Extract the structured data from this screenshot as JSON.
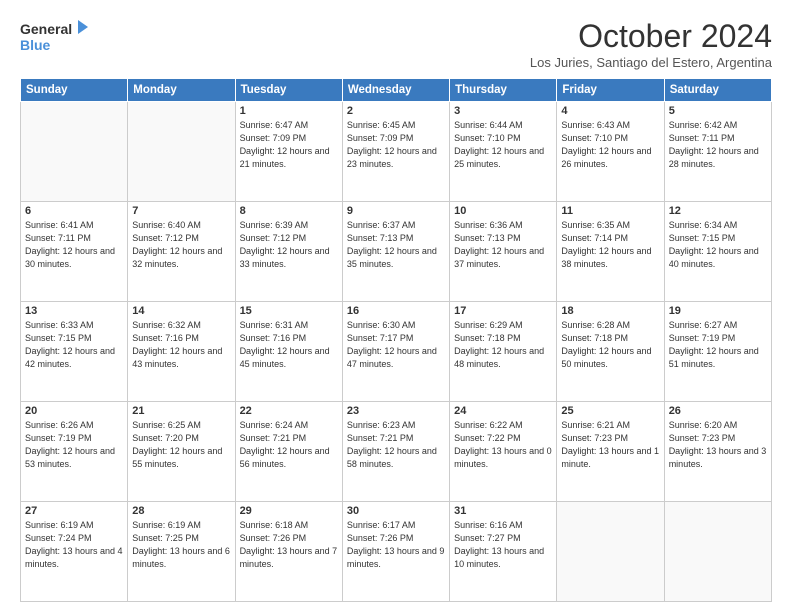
{
  "header": {
    "logo_line1": "General",
    "logo_line2": "Blue",
    "month_title": "October 2024",
    "subtitle": "Los Juries, Santiago del Estero, Argentina"
  },
  "days_of_week": [
    "Sunday",
    "Monday",
    "Tuesday",
    "Wednesday",
    "Thursday",
    "Friday",
    "Saturday"
  ],
  "weeks": [
    [
      {
        "day": "",
        "info": ""
      },
      {
        "day": "",
        "info": ""
      },
      {
        "day": "1",
        "info": "Sunrise: 6:47 AM\nSunset: 7:09 PM\nDaylight: 12 hours and 21 minutes."
      },
      {
        "day": "2",
        "info": "Sunrise: 6:45 AM\nSunset: 7:09 PM\nDaylight: 12 hours and 23 minutes."
      },
      {
        "day": "3",
        "info": "Sunrise: 6:44 AM\nSunset: 7:10 PM\nDaylight: 12 hours and 25 minutes."
      },
      {
        "day": "4",
        "info": "Sunrise: 6:43 AM\nSunset: 7:10 PM\nDaylight: 12 hours and 26 minutes."
      },
      {
        "day": "5",
        "info": "Sunrise: 6:42 AM\nSunset: 7:11 PM\nDaylight: 12 hours and 28 minutes."
      }
    ],
    [
      {
        "day": "6",
        "info": "Sunrise: 6:41 AM\nSunset: 7:11 PM\nDaylight: 12 hours and 30 minutes."
      },
      {
        "day": "7",
        "info": "Sunrise: 6:40 AM\nSunset: 7:12 PM\nDaylight: 12 hours and 32 minutes."
      },
      {
        "day": "8",
        "info": "Sunrise: 6:39 AM\nSunset: 7:12 PM\nDaylight: 12 hours and 33 minutes."
      },
      {
        "day": "9",
        "info": "Sunrise: 6:37 AM\nSunset: 7:13 PM\nDaylight: 12 hours and 35 minutes."
      },
      {
        "day": "10",
        "info": "Sunrise: 6:36 AM\nSunset: 7:13 PM\nDaylight: 12 hours and 37 minutes."
      },
      {
        "day": "11",
        "info": "Sunrise: 6:35 AM\nSunset: 7:14 PM\nDaylight: 12 hours and 38 minutes."
      },
      {
        "day": "12",
        "info": "Sunrise: 6:34 AM\nSunset: 7:15 PM\nDaylight: 12 hours and 40 minutes."
      }
    ],
    [
      {
        "day": "13",
        "info": "Sunrise: 6:33 AM\nSunset: 7:15 PM\nDaylight: 12 hours and 42 minutes."
      },
      {
        "day": "14",
        "info": "Sunrise: 6:32 AM\nSunset: 7:16 PM\nDaylight: 12 hours and 43 minutes."
      },
      {
        "day": "15",
        "info": "Sunrise: 6:31 AM\nSunset: 7:16 PM\nDaylight: 12 hours and 45 minutes."
      },
      {
        "day": "16",
        "info": "Sunrise: 6:30 AM\nSunset: 7:17 PM\nDaylight: 12 hours and 47 minutes."
      },
      {
        "day": "17",
        "info": "Sunrise: 6:29 AM\nSunset: 7:18 PM\nDaylight: 12 hours and 48 minutes."
      },
      {
        "day": "18",
        "info": "Sunrise: 6:28 AM\nSunset: 7:18 PM\nDaylight: 12 hours and 50 minutes."
      },
      {
        "day": "19",
        "info": "Sunrise: 6:27 AM\nSunset: 7:19 PM\nDaylight: 12 hours and 51 minutes."
      }
    ],
    [
      {
        "day": "20",
        "info": "Sunrise: 6:26 AM\nSunset: 7:19 PM\nDaylight: 12 hours and 53 minutes."
      },
      {
        "day": "21",
        "info": "Sunrise: 6:25 AM\nSunset: 7:20 PM\nDaylight: 12 hours and 55 minutes."
      },
      {
        "day": "22",
        "info": "Sunrise: 6:24 AM\nSunset: 7:21 PM\nDaylight: 12 hours and 56 minutes."
      },
      {
        "day": "23",
        "info": "Sunrise: 6:23 AM\nSunset: 7:21 PM\nDaylight: 12 hours and 58 minutes."
      },
      {
        "day": "24",
        "info": "Sunrise: 6:22 AM\nSunset: 7:22 PM\nDaylight: 13 hours and 0 minutes."
      },
      {
        "day": "25",
        "info": "Sunrise: 6:21 AM\nSunset: 7:23 PM\nDaylight: 13 hours and 1 minute."
      },
      {
        "day": "26",
        "info": "Sunrise: 6:20 AM\nSunset: 7:23 PM\nDaylight: 13 hours and 3 minutes."
      }
    ],
    [
      {
        "day": "27",
        "info": "Sunrise: 6:19 AM\nSunset: 7:24 PM\nDaylight: 13 hours and 4 minutes."
      },
      {
        "day": "28",
        "info": "Sunrise: 6:19 AM\nSunset: 7:25 PM\nDaylight: 13 hours and 6 minutes."
      },
      {
        "day": "29",
        "info": "Sunrise: 6:18 AM\nSunset: 7:26 PM\nDaylight: 13 hours and 7 minutes."
      },
      {
        "day": "30",
        "info": "Sunrise: 6:17 AM\nSunset: 7:26 PM\nDaylight: 13 hours and 9 minutes."
      },
      {
        "day": "31",
        "info": "Sunrise: 6:16 AM\nSunset: 7:27 PM\nDaylight: 13 hours and 10 minutes."
      },
      {
        "day": "",
        "info": ""
      },
      {
        "day": "",
        "info": ""
      }
    ]
  ]
}
